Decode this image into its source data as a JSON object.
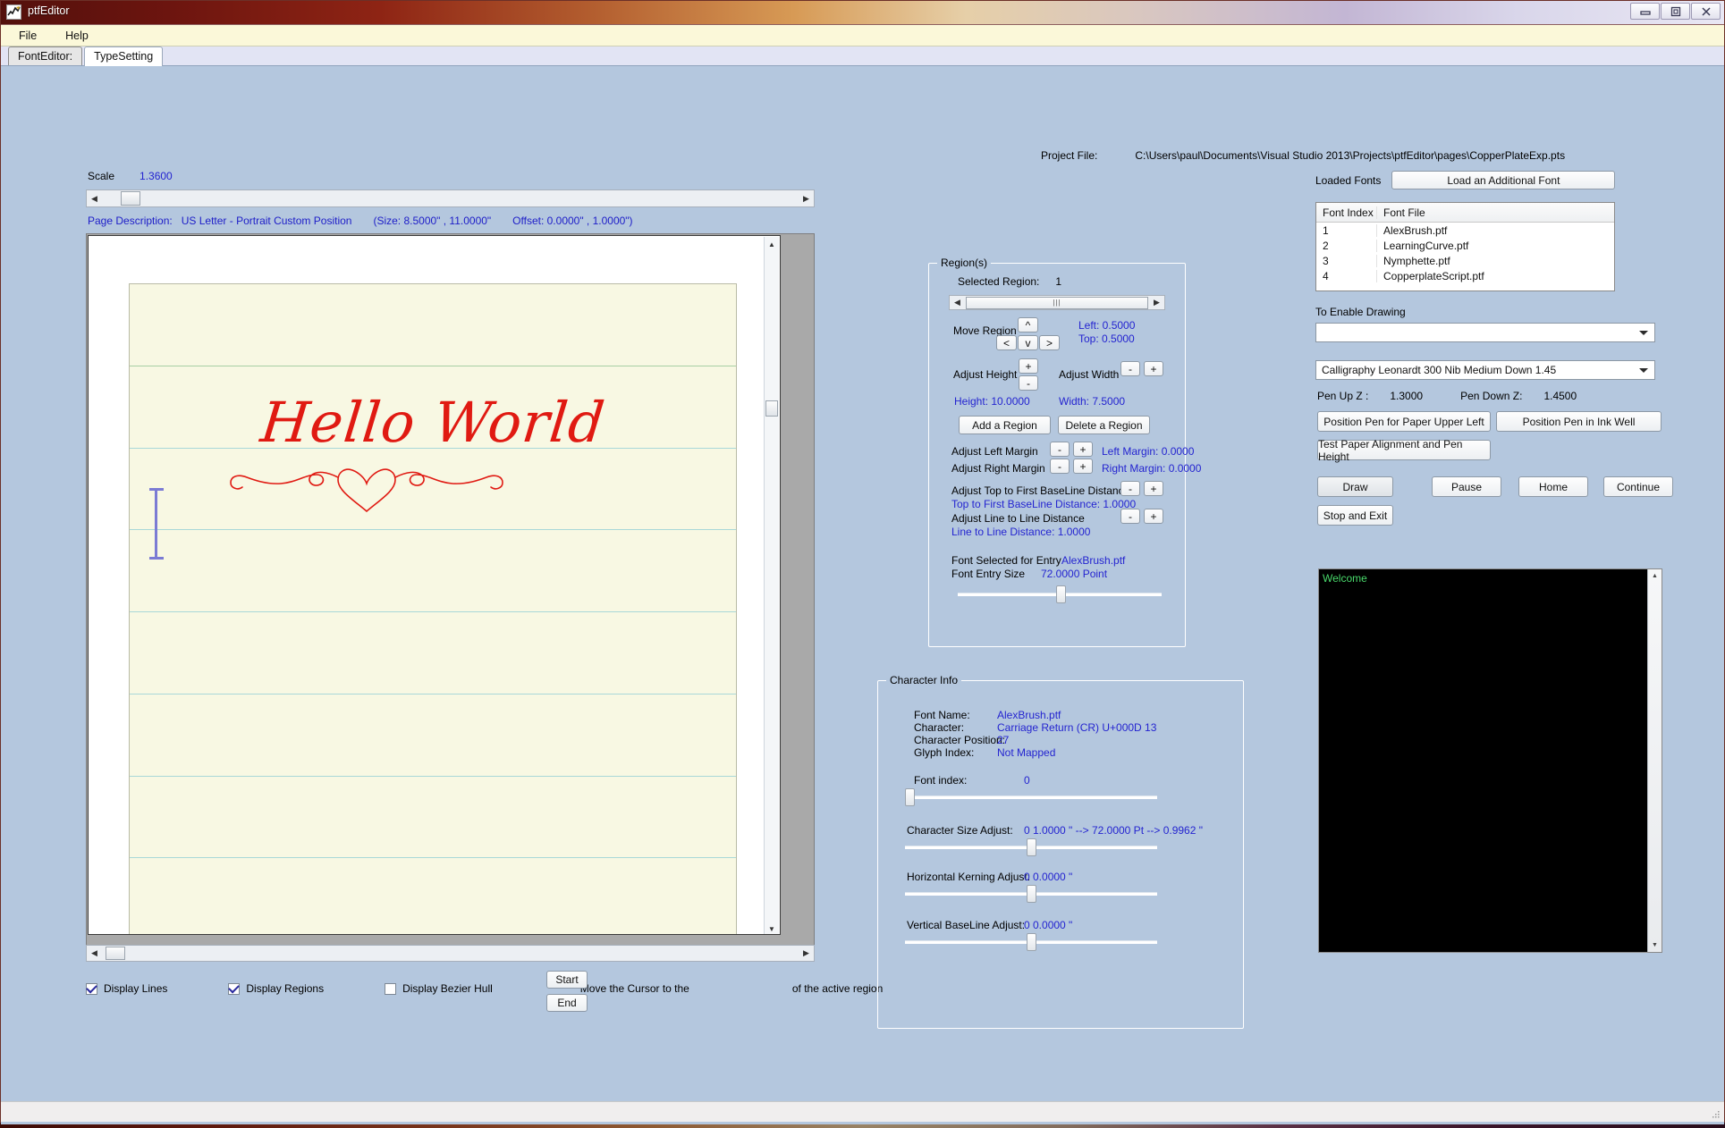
{
  "window": {
    "title": "ptfEditor",
    "minimize_label": "Minimize",
    "maximize_label": "Maximize",
    "close_label": "Close"
  },
  "menu": {
    "items": [
      "File",
      "Help"
    ]
  },
  "tabs": [
    {
      "label": "FontEditor:",
      "selected": false
    },
    {
      "label": "TypeSetting",
      "selected": true
    }
  ],
  "project": {
    "label": "Project File:",
    "path": "C:\\Users\\paul\\Documents\\Visual Studio 2013\\Projects\\ptfEditor\\pages\\CopperPlateExp.pts"
  },
  "canvas": {
    "scale_label": "Scale",
    "scale_value": "1.3600",
    "page_description_label": "Page Description:",
    "page_description_value": "US Letter - Portrait  Custom Position",
    "page_size": "(Size: 8.5000\" , 11.0000\"",
    "page_offset": "Offset: 0.0000\" , 1.0000\")",
    "script_text": "Hello  World",
    "flourish_name": "heart-flourish-ornament",
    "ink_color": "#e01a12",
    "paper_color": "#f8f8e3",
    "rule_line_color": "#a9d8d8",
    "region_line_color": "#a8cfa4",
    "cursor_color": "#7b7bd4"
  },
  "bottom_controls": {
    "checkboxes": [
      {
        "label": "Display Lines",
        "checked": true
      },
      {
        "label": "Display Regions",
        "checked": true
      },
      {
        "label": "Display Bezier Hull",
        "checked": false
      }
    ],
    "move_cursor_prefix": "Move the Cursor to the",
    "move_cursor_suffix": "of the active region",
    "start_label": "Start",
    "end_label": "End"
  },
  "regions": {
    "group_title": "Region(s)",
    "selected_region_label": "Selected Region:",
    "selected_region_value": "1",
    "move_region_label": "Move Region",
    "move_up": "^",
    "move_down": "v",
    "move_left": "<",
    "move_right": ">",
    "left_value": "Left: 0.5000",
    "top_value": "Top: 0.5000",
    "adjust_height_label": "Adjust Height",
    "adjust_width_label": "Adjust Width",
    "plus": "+",
    "minus": "-",
    "height_value": "Height: 10.0000",
    "width_value": "Width: 7.5000",
    "add_region_label": "Add a Region",
    "delete_region_label": "Delete a Region",
    "adjust_left_margin_label": "Adjust Left Margin",
    "left_margin_value": "Left Margin: 0.0000",
    "adjust_right_margin_label": "Adjust Right Margin",
    "right_margin_value": "Right Margin: 0.0000",
    "adjust_top_baseline_label": "Adjust Top to First BaseLine Distance",
    "top_baseline_value": "Top to First BaseLine Distance: 1.0000",
    "adjust_line_to_line_label": "Adjust  Line  to  Line  Distance",
    "line_to_line_value": "Line to Line Distance: 1.0000",
    "font_selected_label": "Font Selected for Entry",
    "font_selected_value": "AlexBrush.ptf",
    "font_entry_size_label": "Font Entry Size",
    "font_entry_size_value": "72.0000  Point"
  },
  "character_info": {
    "group_title": "Character Info",
    "font_name_label": "Font Name:",
    "font_name_value": "AlexBrush.ptf",
    "character_label": "Character:",
    "character_value": "Carriage Return (CR)  U+000D   13",
    "character_position_label": "Character Position:",
    "character_position_value": "27",
    "glyph_index_label": "Glyph Index:",
    "glyph_index_value": "Not Mapped",
    "font_index_label": "Font index:",
    "font_index_value": "0",
    "size_adjust_label": "Character Size Adjust:",
    "size_adjust_value": "0    1.0000  \"  --> 72.0000 Pt  --> 0.9962 \"",
    "kerning_label": "Horizontal Kerning Adjust:",
    "kerning_value": "0    0.0000  \"",
    "baseline_label": "Vertical BaseLine Adjust:",
    "baseline_value": "0    0.0000  \""
  },
  "fonts_panel": {
    "loaded_fonts_label": "Loaded Fonts",
    "load_button_label": "Load an Additional Font",
    "columns": [
      "Font Index",
      "Font File"
    ],
    "rows": [
      {
        "index": "1",
        "file": "AlexBrush.ptf"
      },
      {
        "index": "2",
        "file": "LearningCurve.ptf"
      },
      {
        "index": "3",
        "file": "Nymphette.ptf"
      },
      {
        "index": "4",
        "file": "CopperplateScript.ptf"
      }
    ]
  },
  "drawing_panel": {
    "enable_drawing_label": "To Enable Drawing",
    "enable_drawing_value": "",
    "pen_profile_value": "Calligraphy Leonardt 300 Nib Medium Down 1.45",
    "pen_up_label": "Pen Up Z :",
    "pen_up_value": "1.3000",
    "pen_down_label": "Pen Down Z:",
    "pen_down_value": "1.4500",
    "position_upper_left_label": "Position Pen for Paper Upper Left",
    "position_ink_well_label": "Position Pen in Ink Well",
    "test_alignment_label": "Test Paper Alignment and Pen Height",
    "draw_label": "Draw",
    "pause_label": "Pause",
    "home_label": "Home",
    "continue_label": "Continue",
    "stop_exit_label": "Stop and Exit"
  },
  "console": {
    "lines": [
      "Welcome"
    ],
    "text_color": "#49d96b"
  }
}
